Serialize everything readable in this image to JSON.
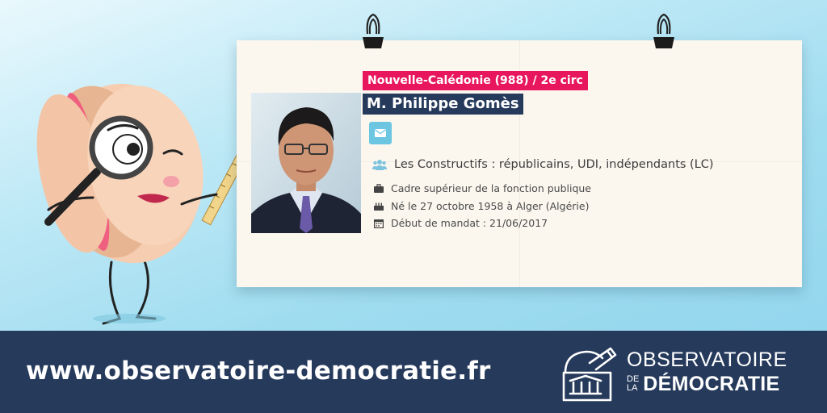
{
  "card": {
    "circonscription": "Nouvelle-Calédonie (988) / 2e circ",
    "name": "M. Philippe Gomès",
    "group": "Les Constructifs : républicains, UDI, indépendants (LC)",
    "profession": "Cadre supérieur de la fonction publique",
    "birth": "Né le 27 octobre 1958 à Alger (Algérie)",
    "mandate_start": "Début de mandat : 21/06/2017"
  },
  "icons": {
    "mail": "envelope-icon",
    "group": "users-icon",
    "profession": "briefcase-icon",
    "birth": "birthday-cake-icon",
    "mandate": "calendar-icon"
  },
  "footer": {
    "url": "www.observatoire-democratie.fr",
    "logo_line1": "OBSERVATOIRE",
    "logo_de": "DE",
    "logo_la": "LA",
    "logo_line2": "DÉMOCRATIE"
  },
  "colors": {
    "circ_tag": "#e8175d",
    "name_tag": "#263a5c",
    "mail_button": "#6cc6e2",
    "footer": "#263a5c"
  }
}
